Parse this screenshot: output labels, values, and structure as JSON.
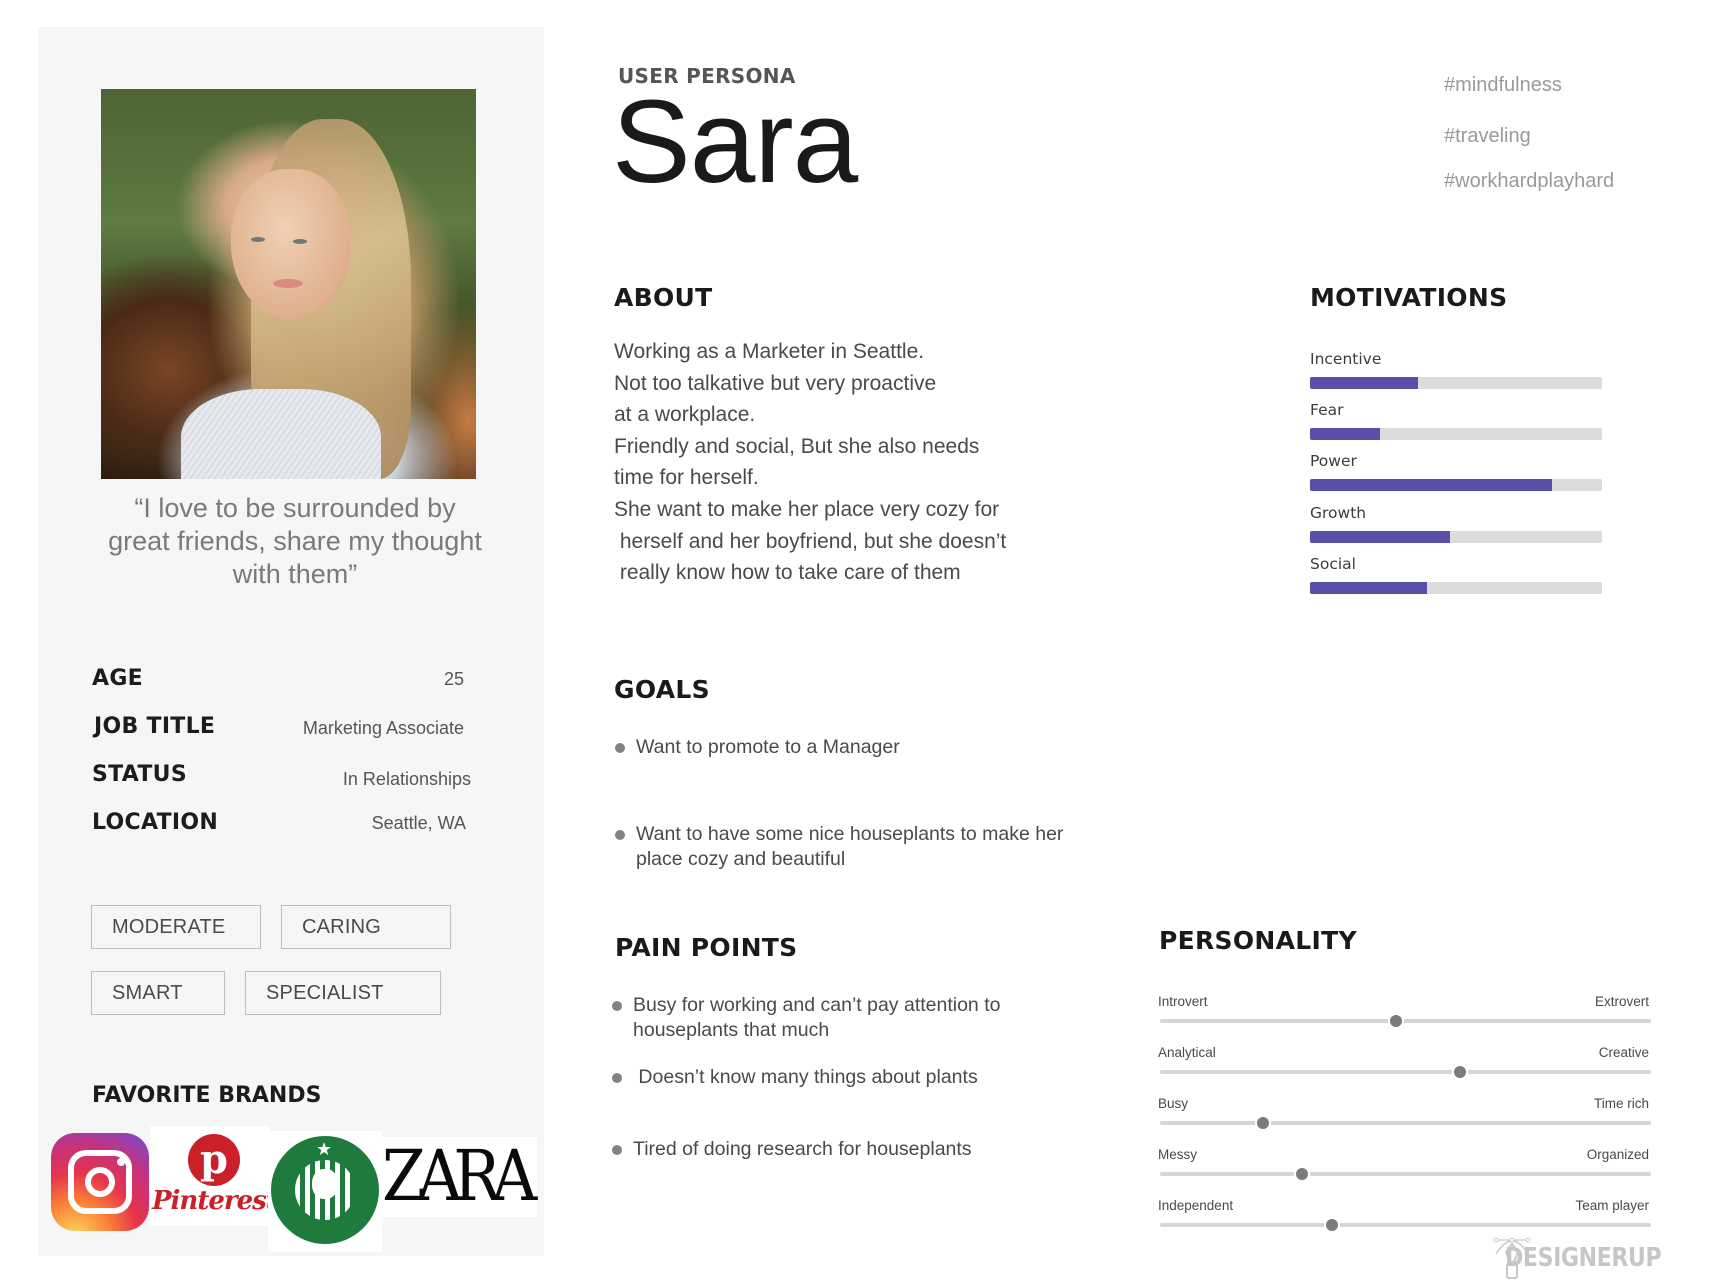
{
  "persona": {
    "eyebrow": "USER PERSONA",
    "name": "Sara",
    "hashtags": [
      "#mindfulness",
      "#traveling",
      "#workhardplayhard"
    ],
    "photo": "portrait-photo",
    "quote": "“I love to be surrounded by great friends, share my thought with them”"
  },
  "info": [
    {
      "label": "AGE",
      "value": "25"
    },
    {
      "label": "JOB TITLE",
      "value": "Marketing Associate"
    },
    {
      "label": "STATUS",
      "value": "In Relationships"
    },
    {
      "label": "LOCATION",
      "value": "Seattle, WA"
    }
  ],
  "traits": [
    "MODERATE",
    "CARING",
    "SMART",
    "SPECIALIST"
  ],
  "brands": {
    "title": "FAVORITE BRANDS",
    "items": [
      {
        "name": "Instagram",
        "icon": "instagram-logo"
      },
      {
        "name": "Pinterest",
        "icon": "pinterest-logo"
      },
      {
        "name": "Starbucks",
        "icon": "starbucks-logo"
      },
      {
        "name": "ZARA",
        "icon": "zara-logo"
      }
    ]
  },
  "about": {
    "title": "ABOUT",
    "lines": [
      "Working as a Marketer in Seattle.",
      "Not too talkative but very proactive",
      "at a workplace.",
      "Friendly and social, But she also needs",
      "time for herself.",
      "She want to make her place very cozy for",
      " herself and her boyfriend, but she doesn’t",
      " really know how to take care of them"
    ]
  },
  "motivations": {
    "title": "MOTIVATIONS",
    "accent_color": "#5a4fa8",
    "track_color": "#dcdcdc",
    "items": [
      {
        "label": "Incentive",
        "value": 0.37
      },
      {
        "label": "Fear",
        "value": 0.24
      },
      {
        "label": "Power",
        "value": 0.83
      },
      {
        "label": "Growth",
        "value": 0.48
      },
      {
        "label": "Social",
        "value": 0.4
      }
    ]
  },
  "goals": {
    "title": "GOALS",
    "items": [
      [
        "Want to promote to a Manager"
      ],
      [
        "Want to have some nice houseplants to make her",
        "place cozy and beautiful"
      ]
    ]
  },
  "pain_points": {
    "title": "PAIN POINTS",
    "items": [
      [
        "Busy for working and can’t pay attention to",
        "houseplants that much"
      ],
      [
        " Doesn’t know many things about plants"
      ],
      [
        "Tired of doing research for houseplants"
      ]
    ]
  },
  "personality": {
    "title": "PERSONALITY",
    "items": [
      {
        "left": "Introvert",
        "right": "Extrovert",
        "value": 0.48
      },
      {
        "left": "Analytical",
        "right": "Creative",
        "value": 0.61
      },
      {
        "left": "Busy",
        "right": "Time rich",
        "value": 0.21
      },
      {
        "left": "Messy",
        "right": "Organized",
        "value": 0.29
      },
      {
        "left": "Independent",
        "right": "Team player",
        "value": 0.35
      }
    ]
  },
  "footer": {
    "brand": "DESIGNERUP"
  }
}
